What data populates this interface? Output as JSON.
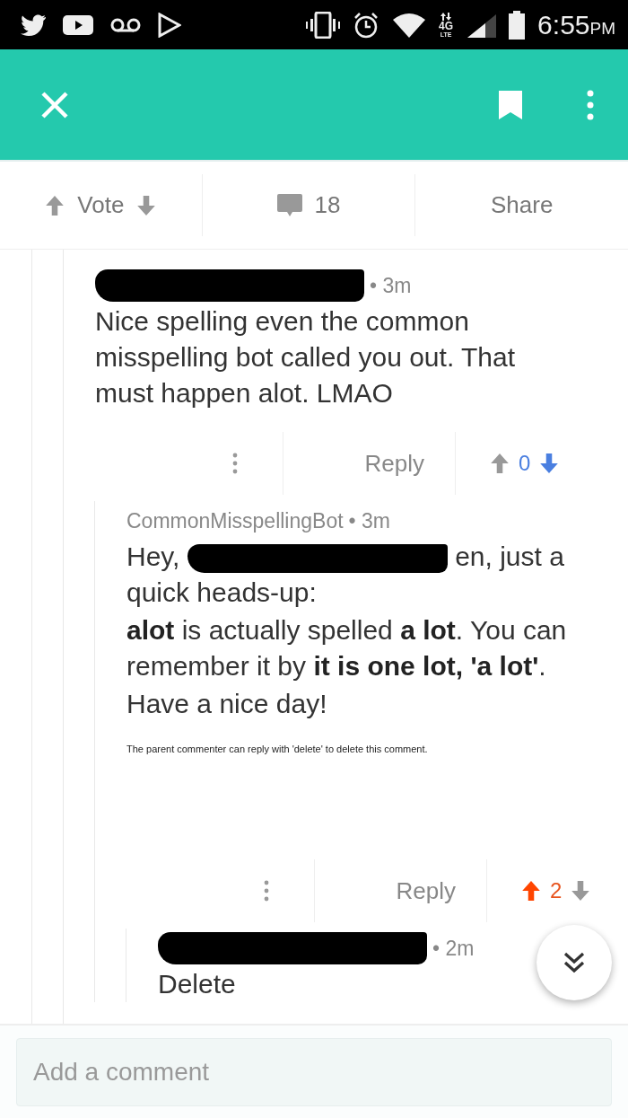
{
  "status_bar": {
    "network": "4G",
    "network_sub": "LTE",
    "time": "6:55",
    "time_suffix": "PM"
  },
  "post_actions": {
    "vote_label": "Vote",
    "upvoted": false,
    "downvoted": false,
    "comment_count": "18",
    "share_label": "Share"
  },
  "comments": [
    {
      "time": "• 3m",
      "body": [
        "Nice spelling even the common misspelling bot called you out. That must happen alot. LMAO"
      ],
      "actions": {
        "reply_label": "Reply",
        "score": "0",
        "upvoted": false,
        "downvoted": true
      }
    },
    {
      "author": "CommonMisspellingBot",
      "time": "• 3m",
      "greeting_start": "Hey,",
      "greeting_redacted": true,
      "greeting_end": "en, just a",
      "body": [
        "quick heads-up:",
        "**alot** is actually spelled **a lot**. You can remember it by **it is one lot, 'a lot'**.",
        "Have a nice day!"
      ],
      "note": "The parent commenter can reply with 'delete' to delete this comment.",
      "actions": {
        "reply_label": "Reply",
        "score": "2",
        "upvoted": true,
        "downvoted": false
      }
    },
    {
      "time": "• 2m",
      "body": [
        "Delete"
      ]
    }
  ],
  "composer": {
    "placeholder": "Add a comment"
  }
}
